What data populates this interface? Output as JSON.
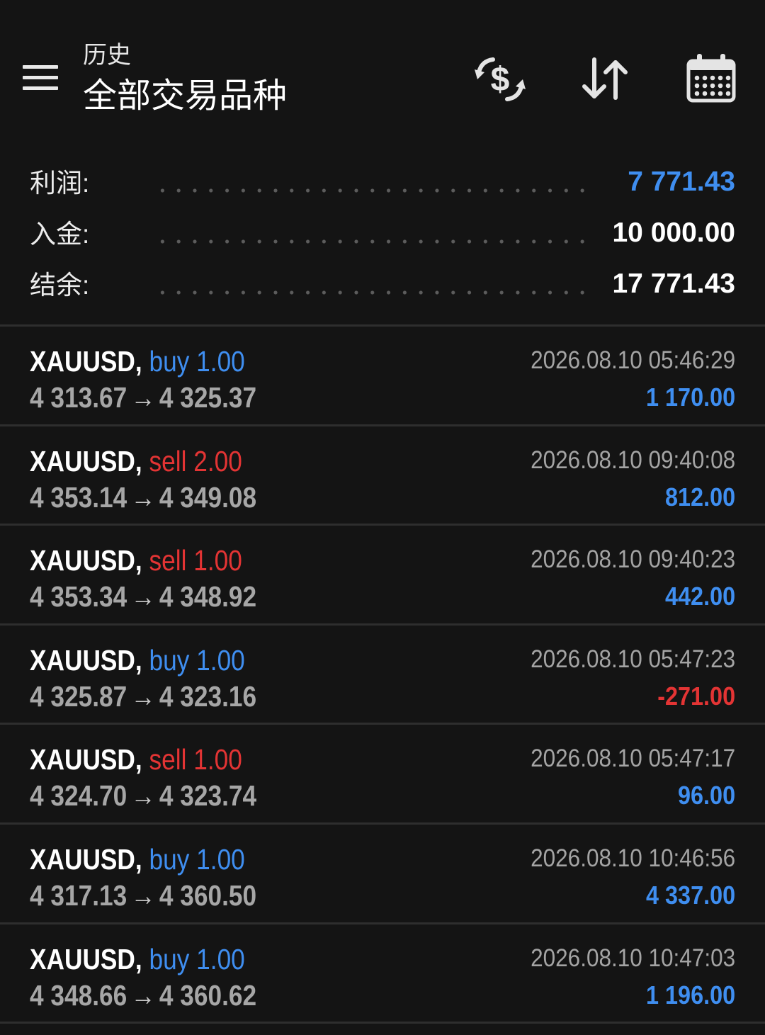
{
  "header": {
    "subtitle": "历史",
    "title": "全部交易品种",
    "menu_icon": "hamburger-menu-icon",
    "tools": [
      {
        "icon": "currency-exchange-icon"
      },
      {
        "icon": "sort-arrows-icon"
      },
      {
        "icon": "calendar-icon"
      }
    ]
  },
  "summary": {
    "profit_label": "利润:",
    "profit_value": "7 771.43",
    "deposit_label": "入金:",
    "deposit_value": "10 000.00",
    "balance_label": "结余:",
    "balance_value": "17 771.43"
  },
  "colors": {
    "buy": "#3f8ef0",
    "sell": "#e33434",
    "profit_positive": "#3f8ef0",
    "profit_negative": "#e33434",
    "background": "#141414"
  },
  "trades": [
    {
      "symbol": "XAUUSD,",
      "direction": "buy",
      "volume": "1.00",
      "open": "4 313.67",
      "arrow": "→",
      "close": "4 325.37",
      "time": "2026.08.10 05:46:29",
      "profit": "1 170.00"
    },
    {
      "symbol": "XAUUSD,",
      "direction": "sell",
      "volume": "2.00",
      "open": "4 353.14",
      "arrow": "→",
      "close": "4 349.08",
      "time": "2026.08.10 09:40:08",
      "profit": "812.00"
    },
    {
      "symbol": "XAUUSD,",
      "direction": "sell",
      "volume": "1.00",
      "open": "4 353.34",
      "arrow": "→",
      "close": "4 348.92",
      "time": "2026.08.10 09:40:23",
      "profit": "442.00"
    },
    {
      "symbol": "XAUUSD,",
      "direction": "buy",
      "volume": "1.00",
      "open": "4 325.87",
      "arrow": "→",
      "close": "4 323.16",
      "time": "2026.08.10 05:47:23",
      "profit": "-271.00"
    },
    {
      "symbol": "XAUUSD,",
      "direction": "sell",
      "volume": "1.00",
      "open": "4 324.70",
      "arrow": "→",
      "close": "4 323.74",
      "time": "2026.08.10 05:47:17",
      "profit": "96.00"
    },
    {
      "symbol": "XAUUSD,",
      "direction": "buy",
      "volume": "1.00",
      "open": "4 317.13",
      "arrow": "→",
      "close": "4 360.50",
      "time": "2026.08.10 10:46:56",
      "profit": "4 337.00"
    },
    {
      "symbol": "XAUUSD,",
      "direction": "buy",
      "volume": "1.00",
      "open": "4 348.66",
      "arrow": "→",
      "close": "4 360.62",
      "time": "2026.08.10 10:47:03",
      "profit": "1 196.00"
    }
  ]
}
